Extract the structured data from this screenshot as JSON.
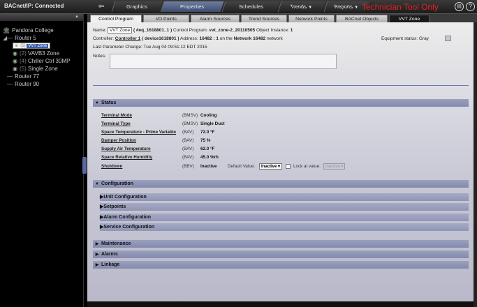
{
  "app": {
    "connection": "BACnet/IP: Connected",
    "tech_only": "Technician Tool Only"
  },
  "nav": {
    "tabs": [
      {
        "label": "Graphics"
      },
      {
        "label": "Properties"
      },
      {
        "label": "Schedules"
      },
      {
        "label": "Trends"
      },
      {
        "label": "Reports"
      }
    ]
  },
  "tree": {
    "root": "Pandora College",
    "router5": "Router 5",
    "items": [
      {
        "num": "(1)",
        "label": "VVT Zone"
      },
      {
        "num": "(2)",
        "label": "VAVB3 Zone"
      },
      {
        "num": "(4)",
        "label": "Chiller Ctrl 30MP"
      },
      {
        "num": "(5)",
        "label": "Single Zone"
      }
    ],
    "router77": "Router 77",
    "router90": "Router 90"
  },
  "subtabs": [
    {
      "label": "Control Program"
    },
    {
      "label": "I/O Points"
    },
    {
      "label": "Alarm Sources"
    },
    {
      "label": "Trend Sources"
    },
    {
      "label": "Network Points"
    },
    {
      "label": "BACnet Objects"
    },
    {
      "label": "VVT Zone"
    }
  ],
  "header": {
    "name_label": "Name:",
    "name_value": "VVT Zone",
    "name_ref": "( #eq_1618801_1 )",
    "control_program_label": "Control Program:",
    "control_program": "vvt_zone-2_20110505",
    "object_instance_label": "Object Instance:",
    "object_instance": "1",
    "controller_label": "Controller:",
    "controller": "Controller 1",
    "device": "( device1618801 )",
    "address_label": "Address:",
    "address": "16482 : 1",
    "network_prefix": "on the",
    "network": "Network 16482",
    "network_suffix": "network",
    "last_change_label": "Last Parameter Change:",
    "last_change": "Tue Aug 04 09:51:12 EDT 2015",
    "equipment_status_label": "Equipment status:",
    "equipment_status": "Gray",
    "notes_label": "Notes:"
  },
  "status": {
    "title": "Status",
    "rows": [
      {
        "label": "Terminal Mode",
        "type": "(BMSV)",
        "value": "Cooling"
      },
      {
        "label": "Terminal Type",
        "type": "(BMSV)",
        "value": "Single Duct"
      },
      {
        "label": "Space Temperature - Prime Variable",
        "type": "(BAV)",
        "value": "72.0 °F"
      },
      {
        "label": "Damper Position",
        "type": "(BAV)",
        "value": "75 %"
      },
      {
        "label": "Supply Air Temperature",
        "type": "(BAV)",
        "value": "62.0 °F"
      },
      {
        "label": "Space Relative Humidity",
        "type": "(BAV)",
        "value": "45.0 %rh"
      },
      {
        "label": "Shutdown",
        "type": "(BBV)",
        "value": "Inactive"
      }
    ],
    "default_value_label": "Default Value:",
    "default_value": "Inactive",
    "lock_label": "Lock at value:",
    "lock_value": "Inactive"
  },
  "configuration": {
    "title": "Configuration",
    "items": [
      {
        "label": "Unit Configuration"
      },
      {
        "label": "Setpoints"
      },
      {
        "label": "Alarm Configuration"
      },
      {
        "label": "Service Configuration"
      }
    ]
  },
  "sections": [
    {
      "label": "Maintenance"
    },
    {
      "label": "Alarms"
    },
    {
      "label": "Linkage"
    }
  ]
}
